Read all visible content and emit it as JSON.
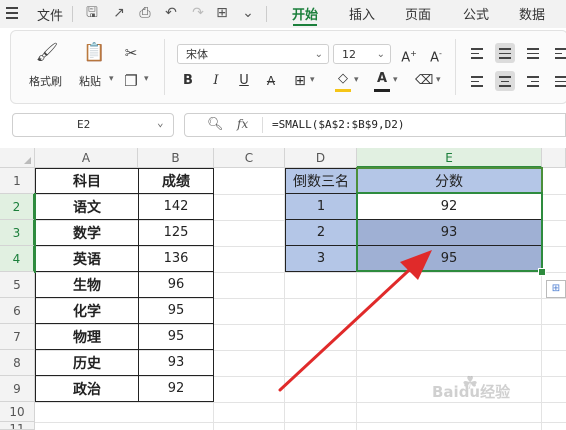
{
  "menubar": {
    "file_label": "文件",
    "tabs": [
      {
        "label": "开始",
        "active": true
      },
      {
        "label": "插入",
        "active": false
      },
      {
        "label": "页面",
        "active": false
      },
      {
        "label": "公式",
        "active": false
      },
      {
        "label": "数据",
        "active": false
      }
    ],
    "accent_color": "#1b7f3b"
  },
  "ribbon": {
    "format_painter_label": "格式刷",
    "paste_label": "粘贴",
    "font_name": "宋体",
    "font_size": "12",
    "bold": "B",
    "italic": "I",
    "underline": "U",
    "font_color": "A"
  },
  "formula_bar": {
    "name_box": "E2",
    "fx": "fx",
    "formula": "=SMALL($A$2:$B$9,D2)"
  },
  "sheet": {
    "columns": [
      "A",
      "B",
      "C",
      "D",
      "E"
    ],
    "rows": [
      "1",
      "2",
      "3",
      "4",
      "5",
      "6",
      "7",
      "8",
      "9",
      "10",
      "11"
    ],
    "table1_header": {
      "subject": "科目",
      "score": "成绩"
    },
    "table1": [
      {
        "subject": "语文",
        "score": "142"
      },
      {
        "subject": "数学",
        "score": "125"
      },
      {
        "subject": "英语",
        "score": "136"
      },
      {
        "subject": "生物",
        "score": "96"
      },
      {
        "subject": "化学",
        "score": "95"
      },
      {
        "subject": "物理",
        "score": "95"
      },
      {
        "subject": "历史",
        "score": "93"
      },
      {
        "subject": "政治",
        "score": "92"
      }
    ],
    "table2_header": {
      "rank": "倒数三名",
      "score": "分数"
    },
    "table2": [
      {
        "rank": "1",
        "score": "92"
      },
      {
        "rank": "2",
        "score": "93"
      },
      {
        "rank": "3",
        "score": "95"
      }
    ],
    "selected_cell": "E2",
    "selection_color": "#2e8b3e",
    "highlight_fill": "#b4c6e7",
    "arrow_color": "#e02a2a"
  },
  "watermark": "Baidu经验"
}
